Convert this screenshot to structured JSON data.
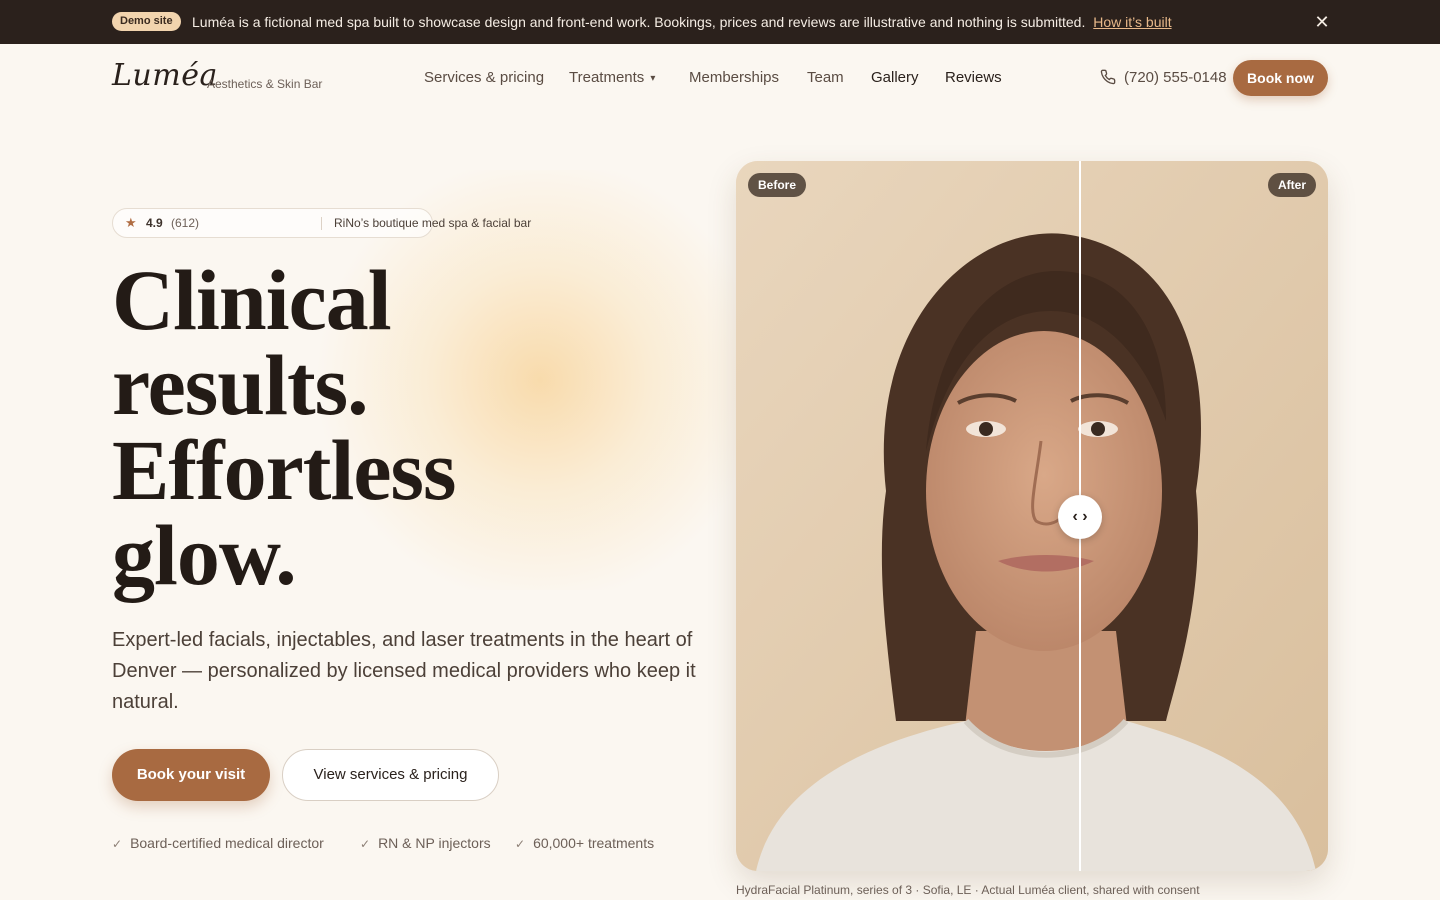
{
  "banner": {
    "badge": "Demo site",
    "message": "Luméa is a fictional med spa built to showcase design and front-end work. Bookings, prices and reviews are illustrative and nothing is submitted.",
    "link": "How it’s built",
    "close_icon": "close-icon"
  },
  "brand": {
    "logo": "Luméa",
    "tagline": "Aesthetics & Skin Bar"
  },
  "nav": {
    "items": [
      "Services & pricing",
      "Treatments",
      "Memberships",
      "Team",
      "Gallery",
      "Reviews"
    ],
    "phone": "(720) 555-0148",
    "book_now": "Book now"
  },
  "hero": {
    "rating": {
      "score": "4.9",
      "count": "(612)",
      "description": "RiNo’s boutique med spa & facial bar"
    },
    "headline": [
      "Clinical",
      "results.",
      "Effortless",
      "glow."
    ],
    "lead": "Expert-led facials, injectables, and laser treatments in the heart of Denver — personalized by licensed medical providers who keep it natural.",
    "primary_cta": "Book your visit",
    "secondary_cta": "View services & pricing",
    "trust": [
      "Board-certified medical director",
      "RN & NP injectors",
      "60,000+ treatments"
    ]
  },
  "compare": {
    "before_label": "Before",
    "after_label": "After",
    "handle": "‹ ›",
    "slider_position": 0.58,
    "caption": "HydraFacial Platinum, series of 3 · Sofia, LE · Actual Luméa client, shared with consent"
  },
  "colors": {
    "accent": "#a86a41",
    "banner_bg": "#2b211c",
    "page_bg": "#fbf7f1"
  }
}
